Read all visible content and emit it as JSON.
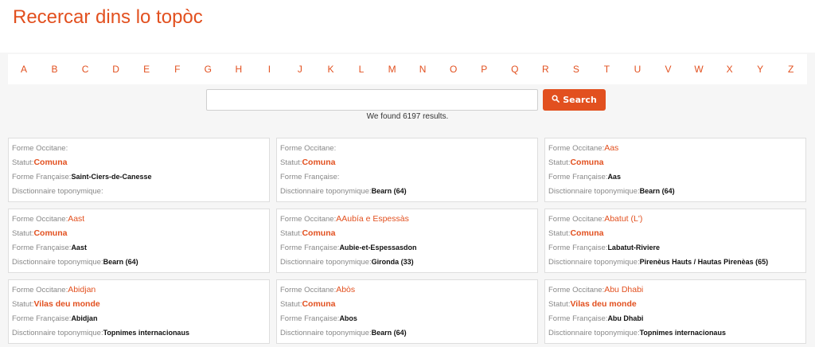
{
  "title": "Recercar dins lo topòc",
  "alphabet": [
    "A",
    "B",
    "C",
    "D",
    "E",
    "F",
    "G",
    "H",
    "I",
    "J",
    "K",
    "L",
    "M",
    "N",
    "O",
    "P",
    "Q",
    "R",
    "S",
    "T",
    "U",
    "V",
    "W",
    "X",
    "Y",
    "Z"
  ],
  "search": {
    "placeholder": "",
    "value": "",
    "button_label": "Search",
    "button_icon": "search-icon"
  },
  "results_text": "We found 6197 results.",
  "labels": {
    "occitane": "Forme Occitane:",
    "statut": "Statut:",
    "francaise": "Forme Française:",
    "dictionnaire": "Disctionnaire toponymique:"
  },
  "cards": [
    {
      "occitane": "",
      "statut": "Comuna",
      "francaise": "Saint-Ciers-de-Canesse",
      "dictionnaire": ""
    },
    {
      "occitane": "",
      "statut": "Comuna",
      "francaise": "",
      "dictionnaire": "Bearn (64)"
    },
    {
      "occitane": "Aas",
      "statut": "Comuna",
      "francaise": "Aas",
      "dictionnaire": "Bearn (64)"
    },
    {
      "occitane": "Aast",
      "statut": "Comuna",
      "francaise": "Aast",
      "dictionnaire": "Bearn (64)"
    },
    {
      "occitane": "AAubía e Espessàs",
      "statut": "Comuna",
      "francaise": "Aubie-et-Espessasdon",
      "dictionnaire": "Gironda (33)"
    },
    {
      "occitane": "Abatut (L')",
      "statut": "Comuna",
      "francaise": "Labatut-Riviere",
      "dictionnaire": "Pirenèus Hauts / Hautas Pirenèas (65)"
    },
    {
      "occitane": "Abidjan",
      "statut": "Vilas deu monde",
      "francaise": "Abidjan",
      "dictionnaire": "Topnimes internacionaus"
    },
    {
      "occitane": "Abòs",
      "statut": "Comuna",
      "francaise": "Abos",
      "dictionnaire": "Bearn (64)"
    },
    {
      "occitane": "Abu Dhabi",
      "statut": "Vilas deu monde",
      "francaise": "Abu Dhabi",
      "dictionnaire": "Topnimes internacionaus"
    }
  ],
  "colors": {
    "accent": "#e2501f",
    "background": "#f6f6f6"
  }
}
